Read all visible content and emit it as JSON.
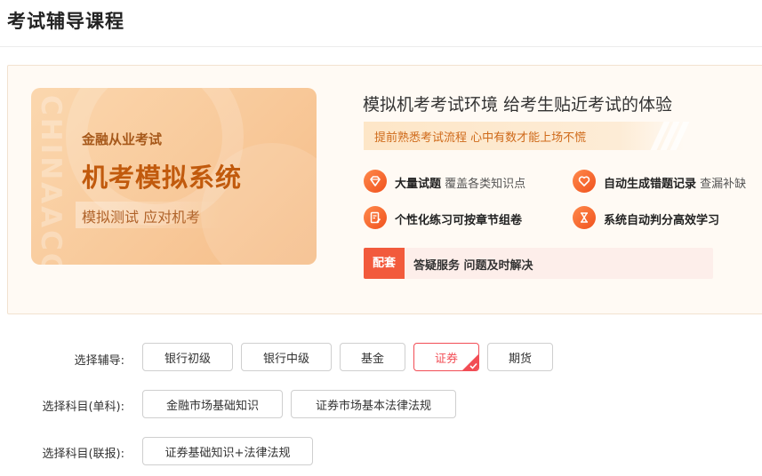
{
  "page": {
    "title": "考试辅导课程"
  },
  "hero": {
    "card": {
      "watermark": "CHINAACC",
      "subtitle": "金融从业考试",
      "title": "机考模拟系统",
      "tagline": "模拟测试 应对机考"
    },
    "headline": "模拟机考考试环境 给考生贴近考试的体验",
    "banner": "提前熟悉考试流程 心中有数才能上场不慌",
    "features": [
      {
        "icon": "diamond-icon",
        "bold": "大量试题",
        "desc": "覆盖各类知识点"
      },
      {
        "icon": "heart-icon",
        "bold": "自动生成错题记录",
        "desc": "查漏补缺"
      },
      {
        "icon": "edit-document-icon",
        "bold": "个性化练习可按章节组卷",
        "desc": ""
      },
      {
        "icon": "hourglass-icon",
        "bold": "系统自动判分高效学习",
        "desc": ""
      }
    ],
    "service": {
      "tag": "配套",
      "text": "答疑服务 问题及时解决"
    }
  },
  "filters": {
    "coaching": {
      "label": "选择辅导:",
      "options": [
        "银行初级",
        "银行中级",
        "基金",
        "证券",
        "期货"
      ],
      "selected": "证券"
    },
    "single_subject": {
      "label": "选择科目(单科):",
      "options": [
        "金融市场基础知识",
        "证券市场基本法律法规"
      ]
    },
    "combined_subject": {
      "label": "选择科目(联报):",
      "options": [
        "证券基础知识+法律法规"
      ]
    }
  },
  "colors": {
    "accent": "#f24d55",
    "orange": "#f0511d",
    "brand_text": "#c15a0d"
  }
}
